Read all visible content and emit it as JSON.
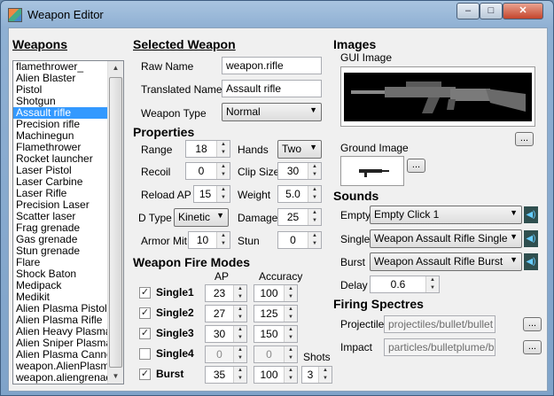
{
  "window": {
    "title": "Weapon Editor",
    "minimize": "–",
    "maximize": "□",
    "close": "✕"
  },
  "weapons": {
    "heading": "Weapons",
    "items": [
      "flamethrower_",
      "Alien Blaster",
      "Pistol",
      "Shotgun",
      "Assault rifle",
      "Precision rifle",
      "Machinegun",
      "Flamethrower",
      "Rocket launcher",
      "Laser Pistol",
      "Laser Carbine",
      "Laser Rifle",
      "Precision Laser",
      "Scatter laser",
      "Frag grenade",
      "Gas grenade",
      "Stun grenade",
      "Flare",
      "Shock Baton",
      "Medipack",
      "Medikit",
      "Alien Plasma Pistol",
      "Alien Plasma Rifle",
      "Alien Heavy Plasma F",
      "Alien Sniper Plasma",
      "Alien Plasma Cannon",
      "weapon.AlienPlasmaC",
      "weapon.aliengrenade"
    ],
    "selected_index": 4
  },
  "selected": {
    "heading": "Selected Weapon",
    "raw_name_label": "Raw Name",
    "raw_name": "weapon.rifle",
    "translated_label": "Translated Name",
    "translated": "Assault rifle",
    "type_label": "Weapon Type",
    "type": "Normal"
  },
  "properties": {
    "heading": "Properties",
    "range_label": "Range",
    "range": "18",
    "hands_label": "Hands",
    "hands": "Two",
    "recoil_label": "Recoil",
    "recoil": "0",
    "clip_label": "Clip Size",
    "clip": "30",
    "reload_label": "Reload AP",
    "reload": "15",
    "weight_label": "Weight",
    "weight": "5.0",
    "dtype_label": "D Type",
    "dtype": "Kinetic",
    "damage_label": "Damage",
    "damage": "25",
    "armor_label": "Armor Mit.",
    "armor": "10",
    "stun_label": "Stun",
    "stun": "0"
  },
  "fire_modes": {
    "heading": "Weapon Fire Modes",
    "ap_header": "AP",
    "acc_header": "Accuracy",
    "shots_header": "Shots",
    "modes": [
      {
        "name": "Single1",
        "checked": true,
        "ap": "23",
        "acc": "100"
      },
      {
        "name": "Single2",
        "checked": true,
        "ap": "27",
        "acc": "125"
      },
      {
        "name": "Single3",
        "checked": true,
        "ap": "30",
        "acc": "150"
      },
      {
        "name": "Single4",
        "checked": false,
        "ap": "0",
        "acc": "0"
      },
      {
        "name": "Burst",
        "checked": true,
        "ap": "35",
        "acc": "100",
        "shots": "3"
      }
    ],
    "check_glyph": "✓"
  },
  "images": {
    "heading": "Images",
    "gui_label": "GUI Image",
    "ground_label": "Ground Image",
    "browse": "..."
  },
  "sounds": {
    "heading": "Sounds",
    "empty_label": "Empty",
    "empty": "Empty Click 1",
    "single_label": "Single",
    "single": "Weapon Assault Rifle Single",
    "burst_label": "Burst",
    "burst": "Weapon Assault Rifle Burst",
    "delay_label": "Delay",
    "delay": "0.6",
    "speaker_glyph": "◀)"
  },
  "spectres": {
    "heading": "Firing Spectres",
    "projectile_label": "Projectile",
    "projectile": "projectiles/bullet/bullet",
    "impact_label": "Impact",
    "impact": "particles/bulletplume/bulletplume"
  },
  "glyphs": {
    "dropdown": "▼",
    "up": "▲",
    "down": "▼"
  }
}
